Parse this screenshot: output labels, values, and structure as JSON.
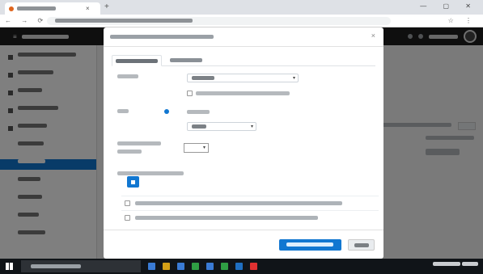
{
  "browser": {
    "tab_close": "×",
    "new_tab": "+",
    "window_controls": "— ▢ ✕",
    "nav_buttons": "← → ⟳",
    "address_icons": "☆ ⋮",
    "favicon_color": "#e0651d"
  },
  "icons": {
    "tab_close": "close-icon",
    "new_tab": "plus-icon",
    "back": "arrow-left-icon",
    "forward": "arrow-right-icon",
    "reload": "reload-icon",
    "modal_close": "close-icon",
    "select_caret": "chevron-down-icon",
    "start": "windows-start-icon"
  },
  "modal": {
    "close": "×",
    "select_caret": "▾",
    "stepper_arrow": "▾",
    "required_mark": "*"
  },
  "colors": {
    "accent": "#1177d1",
    "topbar": "#1e1e1e",
    "backdrop": "#7a7a7a",
    "taskbar": "#101418",
    "required": "#c0392b"
  }
}
